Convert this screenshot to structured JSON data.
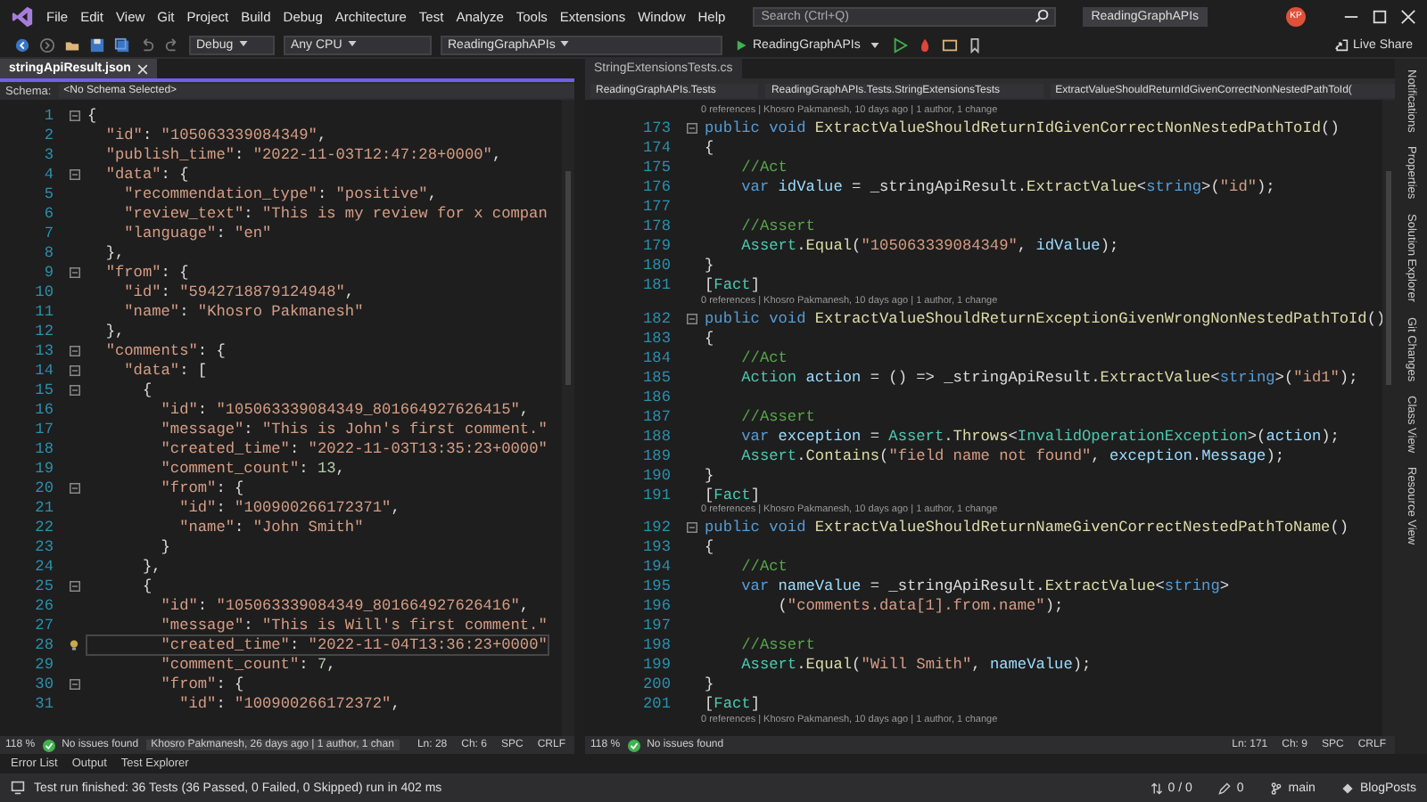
{
  "menu_bar": {
    "items": [
      "File",
      "Edit",
      "View",
      "Git",
      "Project",
      "Build",
      "Debug",
      "Architecture",
      "Test",
      "Analyze",
      "Tools",
      "Extensions",
      "Window",
      "Help"
    ],
    "search": {
      "placeholder": "Search (Ctrl+Q)"
    },
    "solution_title": "ReadingGraphAPIs",
    "avatar": "KP"
  },
  "toolbar": {
    "configuration": "Debug",
    "platform": "Any CPU",
    "startup_project": "ReadingGraphAPIs",
    "run_target": "ReadingGraphAPIs",
    "live_share": "Live Share"
  },
  "panes": [
    {
      "tab": {
        "label": "stringApiResult.json",
        "selected": true
      },
      "nav": [
        {
          "kind": "label",
          "text": "Schema:"
        },
        {
          "kind": "dropdown",
          "text": "<No Schema Selected>"
        }
      ],
      "lines": [
        {
          "kind": "code",
          "num": "1",
          "fold": true,
          "current": false,
          "tokens": [
            {
              "kind": "punct",
              "text": "{"
            }
          ]
        },
        {
          "kind": "code",
          "num": "2",
          "fold": false,
          "current": false,
          "tokens": [
            {
              "kind": "str",
              "text": "  \"id\""
            },
            {
              "kind": "punct",
              "text": ": "
            },
            {
              "kind": "str",
              "text": "\"105063339084349\""
            },
            {
              "kind": "punct",
              "text": ","
            }
          ]
        },
        {
          "kind": "code",
          "num": "3",
          "fold": false,
          "current": false,
          "tokens": [
            {
              "kind": "str",
              "text": "  \"publish_time\""
            },
            {
              "kind": "punct",
              "text": ": "
            },
            {
              "kind": "str",
              "text": "\"2022-11-03T12:47:28+0000\""
            },
            {
              "kind": "punct",
              "text": ","
            }
          ]
        },
        {
          "kind": "code",
          "num": "4",
          "fold": true,
          "current": false,
          "tokens": [
            {
              "kind": "str",
              "text": "  \"data\""
            },
            {
              "kind": "punct",
              "text": ": {"
            }
          ]
        },
        {
          "kind": "code",
          "num": "5",
          "fold": false,
          "current": false,
          "tokens": [
            {
              "kind": "str",
              "text": "    \"recommendation_type\""
            },
            {
              "kind": "punct",
              "text": ": "
            },
            {
              "kind": "str",
              "text": "\"positive\""
            },
            {
              "kind": "punct",
              "text": ","
            }
          ]
        },
        {
          "kind": "code",
          "num": "6",
          "fold": false,
          "current": false,
          "tokens": [
            {
              "kind": "str",
              "text": "    \"review_text\""
            },
            {
              "kind": "punct",
              "text": ": "
            },
            {
              "kind": "str",
              "text": "\"This is my review for x compan"
            }
          ]
        },
        {
          "kind": "code",
          "num": "7",
          "fold": false,
          "current": false,
          "tokens": [
            {
              "kind": "str",
              "text": "    \"language\""
            },
            {
              "kind": "punct",
              "text": ": "
            },
            {
              "kind": "str",
              "text": "\"en\""
            }
          ]
        },
        {
          "kind": "code",
          "num": "8",
          "fold": false,
          "current": false,
          "tokens": [
            {
              "kind": "punct",
              "text": "  },"
            }
          ]
        },
        {
          "kind": "code",
          "num": "9",
          "fold": true,
          "current": false,
          "tokens": [
            {
              "kind": "str",
              "text": "  \"from\""
            },
            {
              "kind": "punct",
              "text": ": {"
            }
          ]
        },
        {
          "kind": "code",
          "num": "10",
          "fold": false,
          "current": false,
          "tokens": [
            {
              "kind": "str",
              "text": "    \"id\""
            },
            {
              "kind": "punct",
              "text": ": "
            },
            {
              "kind": "str",
              "text": "\"5942718879124948\""
            },
            {
              "kind": "punct",
              "text": ","
            }
          ]
        },
        {
          "kind": "code",
          "num": "11",
          "fold": false,
          "current": false,
          "tokens": [
            {
              "kind": "str",
              "text": "    \"name\""
            },
            {
              "kind": "punct",
              "text": ": "
            },
            {
              "kind": "str",
              "text": "\"Khosro Pakmanesh\""
            }
          ]
        },
        {
          "kind": "code",
          "num": "12",
          "fold": false,
          "current": false,
          "tokens": [
            {
              "kind": "punct",
              "text": "  },"
            }
          ]
        },
        {
          "kind": "code",
          "num": "13",
          "fold": true,
          "current": false,
          "tokens": [
            {
              "kind": "str",
              "text": "  \"comments\""
            },
            {
              "kind": "punct",
              "text": ": {"
            }
          ]
        },
        {
          "kind": "code",
          "num": "14",
          "fold": true,
          "current": false,
          "tokens": [
            {
              "kind": "str",
              "text": "    \"data\""
            },
            {
              "kind": "punct",
              "text": ": ["
            }
          ]
        },
        {
          "kind": "code",
          "num": "15",
          "fold": true,
          "current": false,
          "tokens": [
            {
              "kind": "punct",
              "text": "      {"
            }
          ]
        },
        {
          "kind": "code",
          "num": "16",
          "fold": false,
          "current": false,
          "tokens": [
            {
              "kind": "str",
              "text": "        \"id\""
            },
            {
              "kind": "punct",
              "text": ": "
            },
            {
              "kind": "str",
              "text": "\"105063339084349_801664927626415\""
            },
            {
              "kind": "punct",
              "text": ","
            }
          ]
        },
        {
          "kind": "code",
          "num": "17",
          "fold": false,
          "current": false,
          "tokens": [
            {
              "kind": "str",
              "text": "        \"message\""
            },
            {
              "kind": "punct",
              "text": ": "
            },
            {
              "kind": "str",
              "text": "\"This is John's first comment.\""
            }
          ]
        },
        {
          "kind": "code",
          "num": "18",
          "fold": false,
          "current": false,
          "tokens": [
            {
              "kind": "str",
              "text": "        \"created_time\""
            },
            {
              "kind": "punct",
              "text": ": "
            },
            {
              "kind": "str",
              "text": "\"2022-11-03T13:35:23+0000\""
            }
          ]
        },
        {
          "kind": "code",
          "num": "19",
          "fold": false,
          "current": false,
          "tokens": [
            {
              "kind": "str",
              "text": "        \"comment_count\""
            },
            {
              "kind": "punct",
              "text": ": "
            },
            {
              "kind": "num",
              "text": "13"
            },
            {
              "kind": "punct",
              "text": ","
            }
          ]
        },
        {
          "kind": "code",
          "num": "20",
          "fold": true,
          "current": false,
          "tokens": [
            {
              "kind": "str",
              "text": "        \"from\""
            },
            {
              "kind": "punct",
              "text": ": {"
            }
          ]
        },
        {
          "kind": "code",
          "num": "21",
          "fold": false,
          "current": false,
          "tokens": [
            {
              "kind": "str",
              "text": "          \"id\""
            },
            {
              "kind": "punct",
              "text": ": "
            },
            {
              "kind": "str",
              "text": "\"100900266172371\""
            },
            {
              "kind": "punct",
              "text": ","
            }
          ]
        },
        {
          "kind": "code",
          "num": "22",
          "fold": false,
          "current": false,
          "tokens": [
            {
              "kind": "str",
              "text": "          \"name\""
            },
            {
              "kind": "punct",
              "text": ": "
            },
            {
              "kind": "str",
              "text": "\"John Smith\""
            }
          ]
        },
        {
          "kind": "code",
          "num": "23",
          "fold": false,
          "current": false,
          "tokens": [
            {
              "kind": "punct",
              "text": "        }"
            }
          ]
        },
        {
          "kind": "code",
          "num": "24",
          "fold": false,
          "current": false,
          "tokens": [
            {
              "kind": "punct",
              "text": "      },"
            }
          ]
        },
        {
          "kind": "code",
          "num": "25",
          "fold": true,
          "current": false,
          "tokens": [
            {
              "kind": "punct",
              "text": "      {"
            }
          ]
        },
        {
          "kind": "code",
          "num": "26",
          "fold": false,
          "current": false,
          "tokens": [
            {
              "kind": "str",
              "text": "        \"id\""
            },
            {
              "kind": "punct",
              "text": ": "
            },
            {
              "kind": "str",
              "text": "\"105063339084349_801664927626416\""
            },
            {
              "kind": "punct",
              "text": ","
            }
          ]
        },
        {
          "kind": "code",
          "num": "27",
          "fold": false,
          "current": false,
          "tokens": [
            {
              "kind": "str",
              "text": "        \"message\""
            },
            {
              "kind": "punct",
              "text": ": "
            },
            {
              "kind": "str",
              "text": "\"This is Will's first comment.\""
            }
          ]
        },
        {
          "kind": "code",
          "num": "28",
          "fold": false,
          "current": true,
          "tokens": [
            {
              "kind": "str",
              "text": "        \"created_time\""
            },
            {
              "kind": "punct",
              "text": ": "
            },
            {
              "kind": "str",
              "text": "\"2022-11-04T13:36:23+0000\""
            }
          ]
        },
        {
          "kind": "code",
          "num": "29",
          "fold": false,
          "current": false,
          "tokens": [
            {
              "kind": "str",
              "text": "        \"comment_count\""
            },
            {
              "kind": "punct",
              "text": ": "
            },
            {
              "kind": "num",
              "text": "7"
            },
            {
              "kind": "punct",
              "text": ","
            }
          ]
        },
        {
          "kind": "code",
          "num": "30",
          "fold": true,
          "current": false,
          "tokens": [
            {
              "kind": "str",
              "text": "        \"from\""
            },
            {
              "kind": "punct",
              "text": ": {"
            }
          ]
        },
        {
          "kind": "code",
          "num": "31",
          "fold": false,
          "current": false,
          "tokens": [
            {
              "kind": "str",
              "text": "          \"id\""
            },
            {
              "kind": "punct",
              "text": ": "
            },
            {
              "kind": "str",
              "text": "\"100900266172372\""
            },
            {
              "kind": "punct",
              "text": ","
            }
          ]
        }
      ],
      "status": {
        "zoom": "118 %",
        "issues": "No issues found",
        "blame": "Khosro Pakmanesh, 26 days ago | 1 author, 1 chan",
        "position": [
          "Ln: 28",
          "Ch: 6",
          "SPC",
          "CRLF"
        ]
      }
    },
    {
      "tab": {
        "label": "StringExtensionsTests.cs",
        "selected": false
      },
      "nav": [
        {
          "kind": "dropdown",
          "text": "ReadingGraphAPIs.Tests"
        },
        {
          "kind": "dropdown",
          "text": "ReadingGraphAPIs.Tests.StringExtensionsTests"
        },
        {
          "kind": "dropdown",
          "text": "ExtractValueShouldReturnIdGivenCorrectNonNestedPathToId("
        }
      ],
      "lines": [
        {
          "kind": "lens",
          "text": "0 references | Khosro Pakmanesh, 10 days ago | 1 author, 1 change"
        },
        {
          "kind": "code",
          "num": "173",
          "fold": true,
          "tokens": [
            {
              "kind": "kw",
              "text": "public void "
            },
            {
              "kind": "method",
              "text": "ExtractValueShouldReturnIdGivenCorrectNonNestedPathToId"
            },
            {
              "kind": "plain",
              "text": "()"
            }
          ]
        },
        {
          "kind": "code",
          "num": "174",
          "fold": false,
          "tokens": [
            {
              "kind": "plain",
              "text": "{"
            }
          ]
        },
        {
          "kind": "code",
          "num": "175",
          "fold": false,
          "tokens": [
            {
              "kind": "comment",
              "text": "    //Act"
            }
          ]
        },
        {
          "kind": "code",
          "num": "176",
          "fold": false,
          "tokens": [
            {
              "kind": "kw",
              "text": "    var "
            },
            {
              "kind": "var",
              "text": "idValue"
            },
            {
              "kind": "plain",
              "text": " = _stringApiResult."
            },
            {
              "kind": "method",
              "text": "ExtractValue"
            },
            {
              "kind": "plain",
              "text": "<"
            },
            {
              "kind": "kw",
              "text": "string"
            },
            {
              "kind": "plain",
              "text": ">("
            },
            {
              "kind": "str",
              "text": "\"id\""
            },
            {
              "kind": "plain",
              "text": ");"
            }
          ]
        },
        {
          "kind": "code",
          "num": "177",
          "fold": false
        },
        {
          "kind": "code",
          "num": "178",
          "fold": false,
          "tokens": [
            {
              "kind": "comment",
              "text": "    //Assert"
            }
          ]
        },
        {
          "kind": "code",
          "num": "179",
          "fold": false,
          "tokens": [
            {
              "kind": "type",
              "text": "    Assert"
            },
            {
              "kind": "plain",
              "text": "."
            },
            {
              "kind": "method",
              "text": "Equal"
            },
            {
              "kind": "plain",
              "text": "("
            },
            {
              "kind": "str",
              "text": "\"105063339084349\""
            },
            {
              "kind": "plain",
              "text": ", "
            },
            {
              "kind": "var",
              "text": "idValue"
            },
            {
              "kind": "plain",
              "text": ");"
            }
          ]
        },
        {
          "kind": "code",
          "num": "180",
          "fold": false,
          "tokens": [
            {
              "kind": "plain",
              "text": "}"
            }
          ]
        },
        {
          "kind": "code",
          "num": "181",
          "fold": false,
          "tokens": [
            {
              "kind": "plain",
              "text": "["
            },
            {
              "kind": "type",
              "text": "Fact"
            },
            {
              "kind": "plain",
              "text": "]"
            }
          ]
        },
        {
          "kind": "lens",
          "text": "0 references | Khosro Pakmanesh, 10 days ago | 1 author, 1 change"
        },
        {
          "kind": "code",
          "num": "182",
          "fold": true,
          "tokens": [
            {
              "kind": "kw",
              "text": "public void "
            },
            {
              "kind": "method",
              "text": "ExtractValueShouldReturnExceptionGivenWrongNonNestedPathToId"
            },
            {
              "kind": "plain",
              "text": "()"
            }
          ]
        },
        {
          "kind": "code",
          "num": "183",
          "fold": false,
          "tokens": [
            {
              "kind": "plain",
              "text": "{"
            }
          ]
        },
        {
          "kind": "code",
          "num": "184",
          "fold": false,
          "tokens": [
            {
              "kind": "comment",
              "text": "    //Act"
            }
          ]
        },
        {
          "kind": "code",
          "num": "185",
          "fold": false,
          "tokens": [
            {
              "kind": "type",
              "text": "    Action "
            },
            {
              "kind": "var",
              "text": "action"
            },
            {
              "kind": "plain",
              "text": " = () => _stringApiResult."
            },
            {
              "kind": "method",
              "text": "ExtractValue"
            },
            {
              "kind": "plain",
              "text": "<"
            },
            {
              "kind": "kw",
              "text": "string"
            },
            {
              "kind": "plain",
              "text": ">("
            },
            {
              "kind": "str",
              "text": "\"id1\""
            },
            {
              "kind": "plain",
              "text": ");"
            }
          ]
        },
        {
          "kind": "code",
          "num": "186",
          "fold": false
        },
        {
          "kind": "code",
          "num": "187",
          "fold": false,
          "tokens": [
            {
              "kind": "comment",
              "text": "    //Assert"
            }
          ]
        },
        {
          "kind": "code",
          "num": "188",
          "fold": false,
          "tokens": [
            {
              "kind": "kw",
              "text": "    var "
            },
            {
              "kind": "var",
              "text": "exception"
            },
            {
              "kind": "plain",
              "text": " = "
            },
            {
              "kind": "type",
              "text": "Assert"
            },
            {
              "kind": "plain",
              "text": "."
            },
            {
              "kind": "method",
              "text": "Throws"
            },
            {
              "kind": "plain",
              "text": "<"
            },
            {
              "kind": "type",
              "text": "InvalidOperationException"
            },
            {
              "kind": "plain",
              "text": ">("
            },
            {
              "kind": "var",
              "text": "action"
            },
            {
              "kind": "plain",
              "text": ");"
            }
          ]
        },
        {
          "kind": "code",
          "num": "189",
          "fold": false,
          "tokens": [
            {
              "kind": "type",
              "text": "    Assert"
            },
            {
              "kind": "plain",
              "text": "."
            },
            {
              "kind": "method",
              "text": "Contains"
            },
            {
              "kind": "plain",
              "text": "("
            },
            {
              "kind": "str",
              "text": "\"field name not found\""
            },
            {
              "kind": "plain",
              "text": ", "
            },
            {
              "kind": "var",
              "text": "exception"
            },
            {
              "kind": "plain",
              "text": "."
            },
            {
              "kind": "var",
              "text": "Message"
            },
            {
              "kind": "plain",
              "text": ");"
            }
          ]
        },
        {
          "kind": "code",
          "num": "190",
          "fold": false,
          "tokens": [
            {
              "kind": "plain",
              "text": "}"
            }
          ]
        },
        {
          "kind": "code",
          "num": "191",
          "fold": false,
          "tokens": [
            {
              "kind": "plain",
              "text": "["
            },
            {
              "kind": "type",
              "text": "Fact"
            },
            {
              "kind": "plain",
              "text": "]"
            }
          ]
        },
        {
          "kind": "lens",
          "text": "0 references | Khosro Pakmanesh, 10 days ago | 1 author, 1 change"
        },
        {
          "kind": "code",
          "num": "192",
          "fold": true,
          "tokens": [
            {
              "kind": "kw",
              "text": "public void "
            },
            {
              "kind": "method",
              "text": "ExtractValueShouldReturnNameGivenCorrectNestedPathToName"
            },
            {
              "kind": "plain",
              "text": "()"
            }
          ]
        },
        {
          "kind": "code",
          "num": "193",
          "fold": false,
          "tokens": [
            {
              "kind": "plain",
              "text": "{"
            }
          ]
        },
        {
          "kind": "code",
          "num": "194",
          "fold": false,
          "tokens": [
            {
              "kind": "comment",
              "text": "    //Act"
            }
          ]
        },
        {
          "kind": "code",
          "num": "195",
          "fold": false,
          "tokens": [
            {
              "kind": "kw",
              "text": "    var "
            },
            {
              "kind": "var",
              "text": "nameValue"
            },
            {
              "kind": "plain",
              "text": " = _stringApiResult."
            },
            {
              "kind": "method",
              "text": "ExtractValue"
            },
            {
              "kind": "plain",
              "text": "<"
            },
            {
              "kind": "kw",
              "text": "string"
            },
            {
              "kind": "plain",
              "text": ">"
            }
          ]
        },
        {
          "kind": "code",
          "num": "196",
          "fold": false,
          "tokens": [
            {
              "kind": "plain",
              "text": "        ("
            },
            {
              "kind": "str",
              "text": "\"comments.data[1].from.name\""
            },
            {
              "kind": "plain",
              "text": ");"
            }
          ]
        },
        {
          "kind": "code",
          "num": "197",
          "fold": false
        },
        {
          "kind": "code",
          "num": "198",
          "fold": false,
          "tokens": [
            {
              "kind": "comment",
              "text": "    //Assert"
            }
          ]
        },
        {
          "kind": "code",
          "num": "199",
          "fold": false,
          "tokens": [
            {
              "kind": "type",
              "text": "    Assert"
            },
            {
              "kind": "plain",
              "text": "."
            },
            {
              "kind": "method",
              "text": "Equal"
            },
            {
              "kind": "plain",
              "text": "("
            },
            {
              "kind": "str",
              "text": "\"Will Smith\""
            },
            {
              "kind": "plain",
              "text": ", "
            },
            {
              "kind": "var",
              "text": "nameValue"
            },
            {
              "kind": "plain",
              "text": ");"
            }
          ]
        },
        {
          "kind": "code",
          "num": "200",
          "fold": false,
          "tokens": [
            {
              "kind": "plain",
              "text": "}"
            }
          ]
        },
        {
          "kind": "code",
          "num": "201",
          "fold": false,
          "tokens": [
            {
              "kind": "plain",
              "text": "["
            },
            {
              "kind": "type",
              "text": "Fact"
            },
            {
              "kind": "plain",
              "text": "]"
            }
          ]
        },
        {
          "kind": "lens",
          "text": "0 references | Khosro Pakmanesh, 10 days ago | 1 author, 1 change"
        }
      ],
      "status": {
        "zoom": "118 %",
        "issues": "No issues found",
        "position": [
          "Ln: 171",
          "Ch: 9",
          "SPC",
          "CRLF"
        ]
      }
    }
  ],
  "side_tabs": [
    "Notifications",
    "Properties",
    "Solution Explorer",
    "Git Changes",
    "Class View",
    "Resource View"
  ],
  "bottom_tabs": [
    "Error List",
    "Output",
    "Test Explorer"
  ],
  "status_bar": {
    "message": "Test run finished: 36 Tests (36 Passed, 0 Failed, 0 Skipped) run in 402 ms",
    "items": [
      {
        "kind": "updown",
        "text": "0 / 0"
      },
      {
        "kind": "pencil",
        "text": "0"
      },
      {
        "kind": "branch",
        "text": "main"
      },
      {
        "kind": "repo",
        "text": "BlogPosts"
      }
    ]
  }
}
